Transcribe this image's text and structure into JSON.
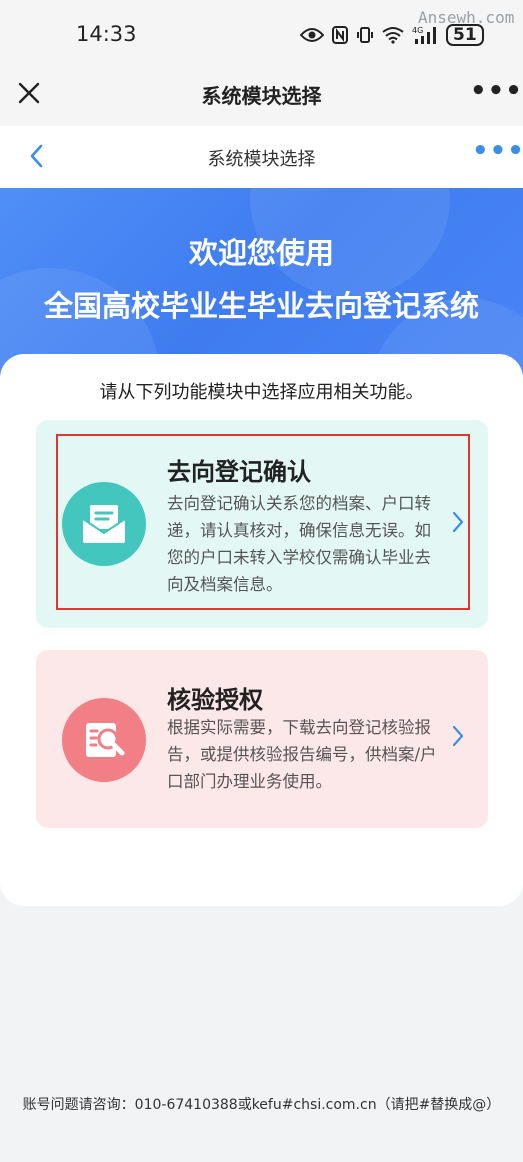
{
  "status_bar": {
    "time": "14:33",
    "network": "4G",
    "battery": "51",
    "watermark": "Ansewh.com"
  },
  "app_bar": {
    "title": "系统模块选择",
    "more": "•••"
  },
  "nav_bar": {
    "title": "系统模块选择",
    "more": "•••"
  },
  "banner": {
    "line1": "欢迎您使用",
    "line2": "全国高校毕业生毕业去向登记系统"
  },
  "panel": {
    "intro": "请从下列功能模块中选择应用相关功能。"
  },
  "modules": [
    {
      "title": "去向登记确认",
      "desc": "去向登记确认关系您的档案、户口转递，请认真核对，确保信息无误。如您的户口未转入学校仅需确认毕业去向及档案信息。",
      "icon": "envelope-document-icon",
      "color": "#43c6bd",
      "background": "#e3f8f5",
      "highlighted": true
    },
    {
      "title": "核验授权",
      "desc": "根据实际需要，下载去向登记核验报告，或提供核验报告编号，供档案/户口部门办理业务使用。",
      "icon": "search-report-icon",
      "color": "#f27e86",
      "background": "#fde8e9",
      "highlighted": false
    }
  ],
  "footer": {
    "text": "账号问题请咨询：010-67410388或kefu#chsi.com.cn（请把#替换成@）"
  },
  "colors": {
    "accent": "#3a8ee6",
    "banner": "#4a86f5",
    "highlight_border": "#e3352c"
  }
}
